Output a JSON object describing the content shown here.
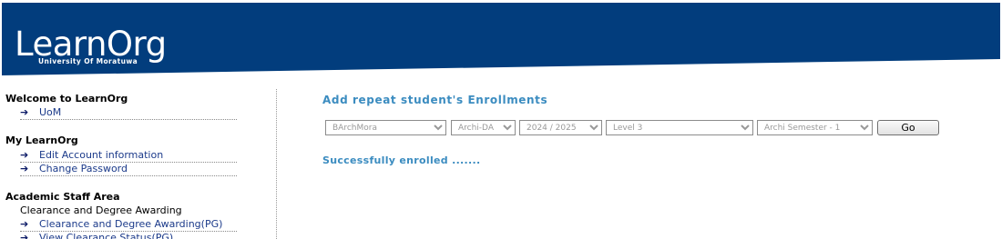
{
  "header": {
    "logo_main": "LearnOrg",
    "logo_sub": "University Of Moratuwa",
    "band_color": "#023d7d"
  },
  "sidebar": {
    "sections": [
      {
        "title": "Welcome to LearnOrg",
        "links": [
          {
            "label": "UoM",
            "icon": "arrow-right-icon"
          }
        ]
      },
      {
        "title": "My LearnOrg",
        "links": [
          {
            "label": "Edit Account information",
            "icon": "arrow-right-icon"
          },
          {
            "label": "Change Password",
            "icon": "arrow-right-icon"
          }
        ]
      },
      {
        "title": "Academic Staff Area",
        "subheading": "Clearance and Degree Awarding",
        "links": [
          {
            "label": "Clearance and Degree Awarding(PG)",
            "icon": "arrow-right-icon"
          },
          {
            "label": "View Clearance Status(PG)",
            "icon": "arrow-right-icon"
          }
        ]
      }
    ]
  },
  "main": {
    "title": "Add repeat student's Enrollments",
    "selects": [
      {
        "name": "institute-select",
        "value": "BArchMora"
      },
      {
        "name": "course-select",
        "value": "Archi-DA"
      },
      {
        "name": "year-select",
        "value": "2024 / 2025"
      },
      {
        "name": "level-select",
        "value": "Level 3"
      },
      {
        "name": "semester-select",
        "value": "Archi Semester - 1"
      }
    ],
    "go_label": "Go",
    "status_message": "Successfully enrolled ......."
  },
  "colors": {
    "accent": "#3b8cc0",
    "link": "#1b3a8a",
    "header": "#023d7d"
  }
}
